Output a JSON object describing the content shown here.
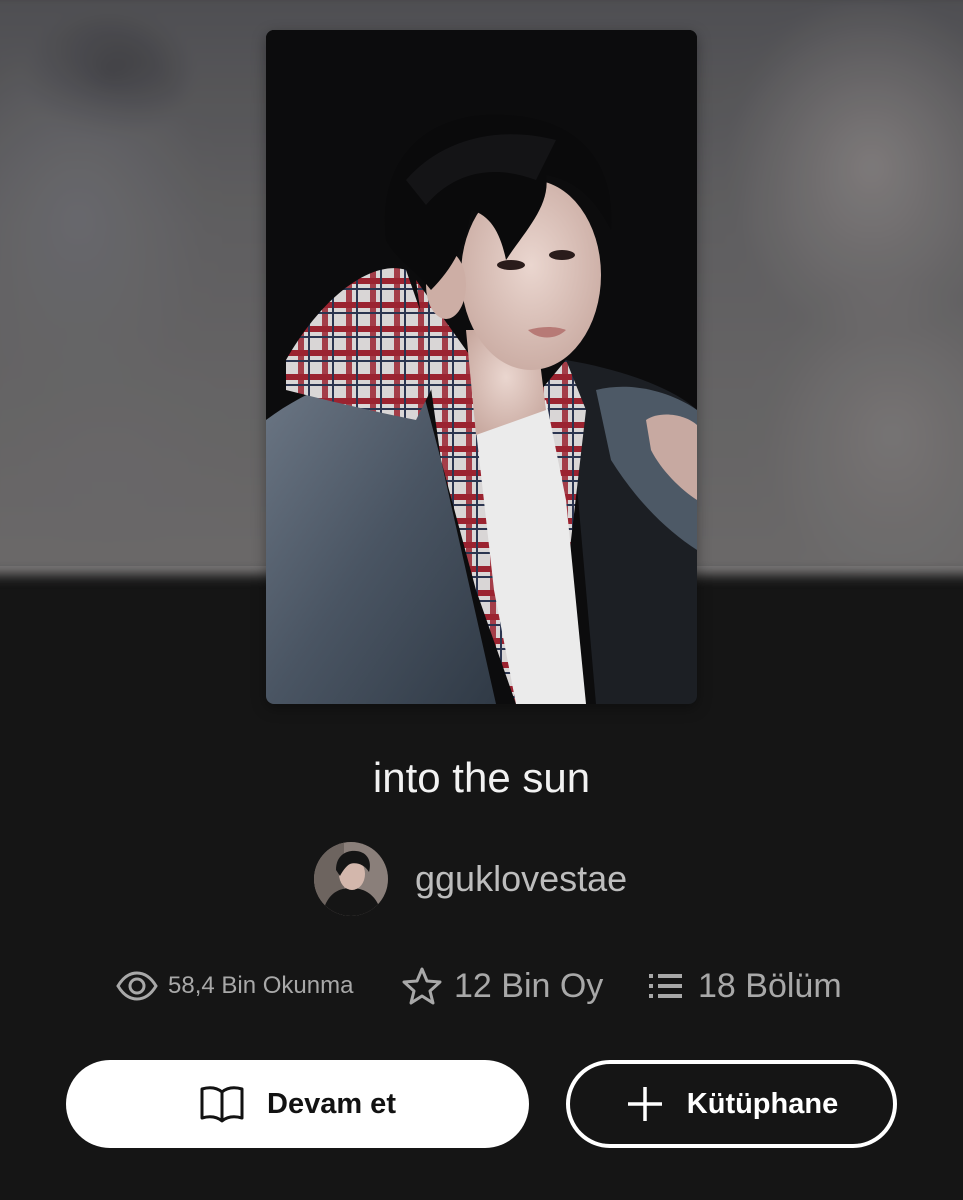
{
  "story": {
    "title": "into the sun"
  },
  "author": {
    "username": "gguklovestae"
  },
  "stats": {
    "reads": "58,4 Bin Okunma",
    "votes": "12 Bin Oy",
    "parts": "18 Bölüm"
  },
  "actions": {
    "continue_label": "Devam et",
    "library_label": "Kütüphane"
  },
  "icons": {
    "reads": "eye-icon",
    "votes": "star-icon",
    "parts": "list-icon",
    "continue": "book-open-icon",
    "library": "plus-icon"
  },
  "colors": {
    "background": "#151515",
    "title_text": "#f2f2f2",
    "stat_text": "#a8a8a8",
    "primary_button": "#ffffff",
    "primary_button_text": "#121212"
  }
}
